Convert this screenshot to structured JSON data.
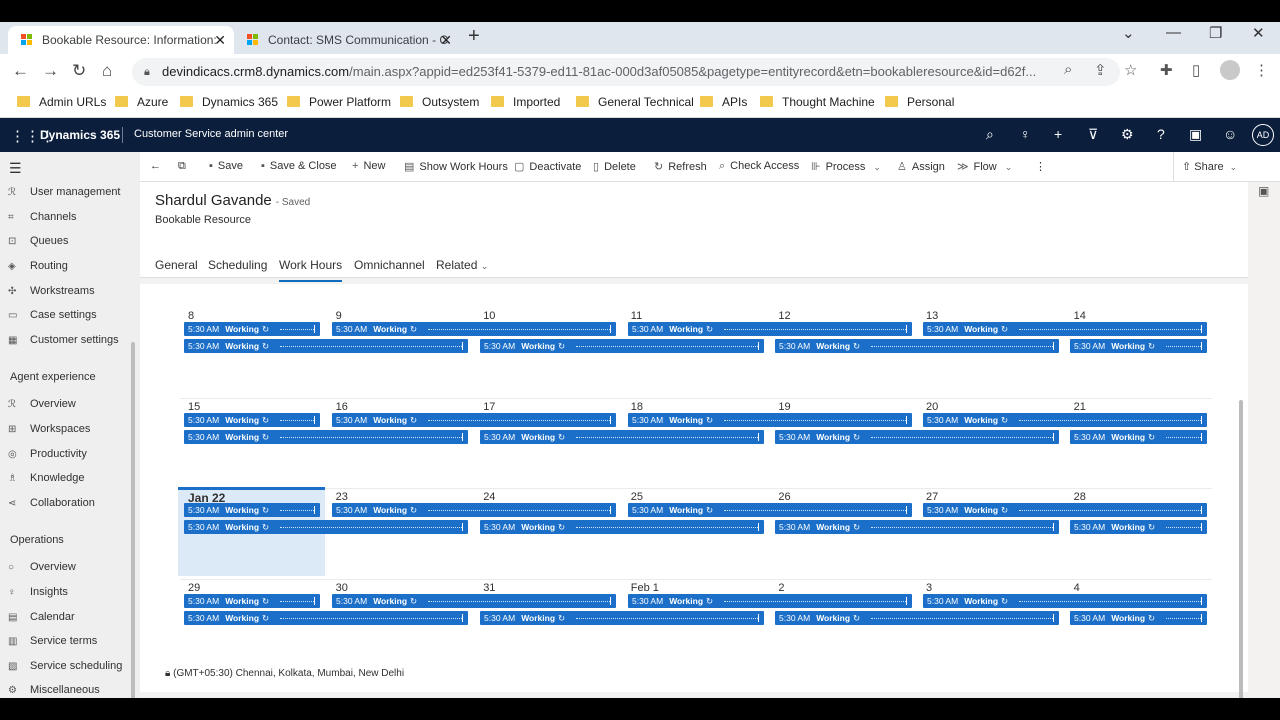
{
  "browser": {
    "tabs": [
      {
        "title": "Bookable Resource: Information:",
        "active": true
      },
      {
        "title": "Contact: SMS Communication - C",
        "active": false
      }
    ],
    "url_main": "devindicacs.crm8.dynamics.com",
    "url_rest": "/main.aspx?appid=ed253f41-5379-ed11-81ac-000d3af05085&pagetype=entityrecord&etn=bookableresource&id=d62f...",
    "bookmarks": [
      "Admin URLs",
      "Azure",
      "Dynamics 365",
      "Power Platform",
      "Outsystem",
      "Imported",
      "General Technical",
      "APIs",
      "Thought Machine",
      "Personal"
    ]
  },
  "app": {
    "brand": "Dynamics 365",
    "app_name": "Customer Service admin center",
    "user_initials": "AD"
  },
  "sidebar": {
    "items_top": [
      "User management",
      "Channels",
      "Queues",
      "Routing",
      "Workstreams",
      "Case settings",
      "Customer settings"
    ],
    "agent_heading": "Agent experience",
    "agent_items": [
      "Overview",
      "Workspaces",
      "Productivity",
      "Knowledge",
      "Collaboration"
    ],
    "ops_heading": "Operations",
    "ops_items": [
      "Overview",
      "Insights",
      "Calendar",
      "Service terms",
      "Service scheduling",
      "Miscellaneous"
    ]
  },
  "commands": {
    "save": "Save",
    "save_close": "Save & Close",
    "new": "New",
    "show_work_hours": "Show Work Hours",
    "deactivate": "Deactivate",
    "delete": "Delete",
    "refresh": "Refresh",
    "check_access": "Check Access",
    "process": "Process",
    "assign": "Assign",
    "flow": "Flow",
    "share": "Share"
  },
  "record": {
    "name": "Shardul Gavande",
    "status": "- Saved",
    "entity": "Bookable Resource",
    "tabs": [
      "General",
      "Scheduling",
      "Work Hours",
      "Omnichannel",
      "Related"
    ],
    "active_tab": "Work Hours"
  },
  "calendar": {
    "weeks": [
      [
        "8",
        "9",
        "10",
        "11",
        "12",
        "13",
        "14"
      ],
      [
        "15",
        "16",
        "17",
        "18",
        "19",
        "20",
        "21"
      ],
      [
        "Jan 22",
        "23",
        "24",
        "25",
        "26",
        "27",
        "28"
      ],
      [
        "29",
        "30",
        "31",
        "Feb 1",
        "2",
        "3",
        "4"
      ]
    ],
    "today_label": "Jan 22",
    "event_time": "5:30 AM",
    "event_label": "Working",
    "timezone": "(GMT+05:30) Chennai, Kolkata, Mumbai, New Delhi"
  },
  "colors": {
    "header_bg": "#0b1e3c",
    "event_bg": "#1b6fc8",
    "today_bg": "#dce9f7",
    "today_line": "#1b6fc8"
  }
}
